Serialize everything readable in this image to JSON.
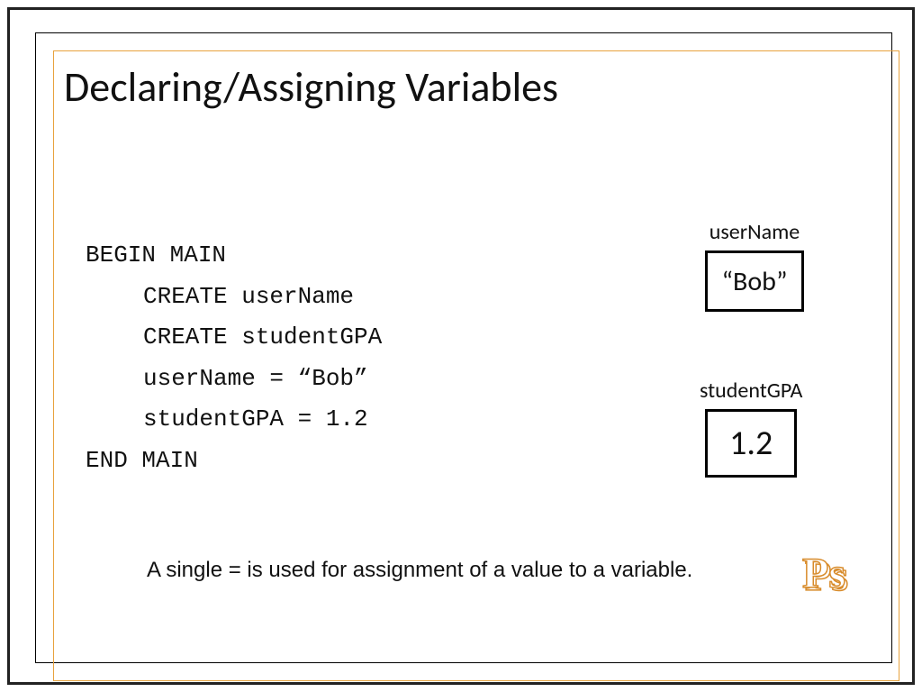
{
  "title": "Declaring/Assigning Variables",
  "code": {
    "begin": "BEGIN MAIN",
    "line1": "CREATE userName",
    "line2": "CREATE studentGPA",
    "line3": "userName = “Bob”",
    "line4": "studentGPA = 1.2",
    "end": "END MAIN"
  },
  "boxes": {
    "b1": {
      "label": "userName",
      "value": "“Bob”"
    },
    "b2": {
      "label": "studentGPA",
      "value": "1.2"
    }
  },
  "footnote": "A single = is used for assignment of a value to a variable.",
  "logo": "Ps"
}
